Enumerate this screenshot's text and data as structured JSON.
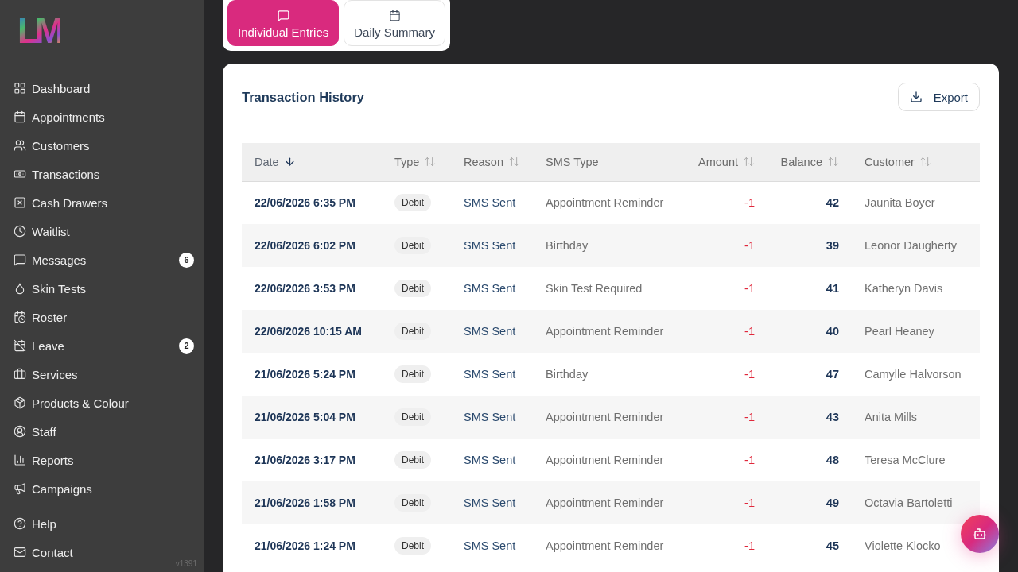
{
  "sidebar": {
    "logo": "LM",
    "nav_items": [
      {
        "label": "Dashboard"
      },
      {
        "label": "Appointments"
      },
      {
        "label": "Customers"
      },
      {
        "label": "Transactions"
      },
      {
        "label": "Cash Drawers"
      },
      {
        "label": "Waitlist"
      },
      {
        "label": "Messages",
        "badge": "6"
      },
      {
        "label": "Skin Tests"
      },
      {
        "label": "Roster"
      },
      {
        "label": "Leave",
        "badge": "2"
      },
      {
        "label": "Services"
      },
      {
        "label": "Products & Colour"
      },
      {
        "label": "Staff"
      },
      {
        "label": "Reports"
      },
      {
        "label": "Campaigns"
      }
    ],
    "footer_items": [
      {
        "label": "Help"
      },
      {
        "label": "Contact"
      }
    ],
    "version": "v1391"
  },
  "view_tabs": [
    {
      "label": "Individual Entries",
      "selected": true
    },
    {
      "label": "Daily Summary",
      "selected": false
    }
  ],
  "transaction_history": {
    "title": "Transaction History",
    "export_button": "Export",
    "table": {
      "columns": [
        {
          "label": "Date",
          "sortable": true,
          "sorted": true
        },
        {
          "label": "Type",
          "sortable": true,
          "sorted": false
        },
        {
          "label": "Reason",
          "sortable": true,
          "sorted": false
        },
        {
          "label": "SMS Type",
          "sortable": false,
          "sorted": false
        },
        {
          "label": "Amount",
          "sortable": true,
          "sorted": false
        },
        {
          "label": "Balance",
          "sortable": true,
          "sorted": false
        },
        {
          "label": "Customer",
          "sortable": true,
          "sorted": false
        }
      ],
      "rows": [
        {
          "date": "22/06/2026 6:35 PM",
          "type": "Debit",
          "reason": "SMS Sent",
          "sms_type": "Appointment Reminder",
          "amount": "-1",
          "balance": "42",
          "customer": "Jaunita Boyer"
        },
        {
          "date": "22/06/2026 6:02 PM",
          "type": "Debit",
          "reason": "SMS Sent",
          "sms_type": "Birthday",
          "amount": "-1",
          "balance": "39",
          "customer": "Leonor Daugherty"
        },
        {
          "date": "22/06/2026 3:53 PM",
          "type": "Debit",
          "reason": "SMS Sent",
          "sms_type": "Skin Test Required",
          "amount": "-1",
          "balance": "41",
          "customer": "Katheryn Davis"
        },
        {
          "date": "22/06/2026 10:15 AM",
          "type": "Debit",
          "reason": "SMS Sent",
          "sms_type": "Appointment Reminder",
          "amount": "-1",
          "balance": "40",
          "customer": "Pearl Heaney"
        },
        {
          "date": "21/06/2026 5:24 PM",
          "type": "Debit",
          "reason": "SMS Sent",
          "sms_type": "Birthday",
          "amount": "-1",
          "balance": "47",
          "customer": "Camylle Halvorson"
        },
        {
          "date": "21/06/2026 5:04 PM",
          "type": "Debit",
          "reason": "SMS Sent",
          "sms_type": "Appointment Reminder",
          "amount": "-1",
          "balance": "43",
          "customer": "Anita Mills"
        },
        {
          "date": "21/06/2026 3:17 PM",
          "type": "Debit",
          "reason": "SMS Sent",
          "sms_type": "Appointment Reminder",
          "amount": "-1",
          "balance": "48",
          "customer": "Teresa McClure"
        },
        {
          "date": "21/06/2026 1:58 PM",
          "type": "Debit",
          "reason": "SMS Sent",
          "sms_type": "Appointment Reminder",
          "amount": "-1",
          "balance": "49",
          "customer": "Octavia Bartoletti"
        },
        {
          "date": "21/06/2026 1:24 PM",
          "type": "Debit",
          "reason": "SMS Sent",
          "sms_type": "Appointment Reminder",
          "amount": "-1",
          "balance": "45",
          "customer": "Violette Klocko"
        }
      ]
    }
  }
}
